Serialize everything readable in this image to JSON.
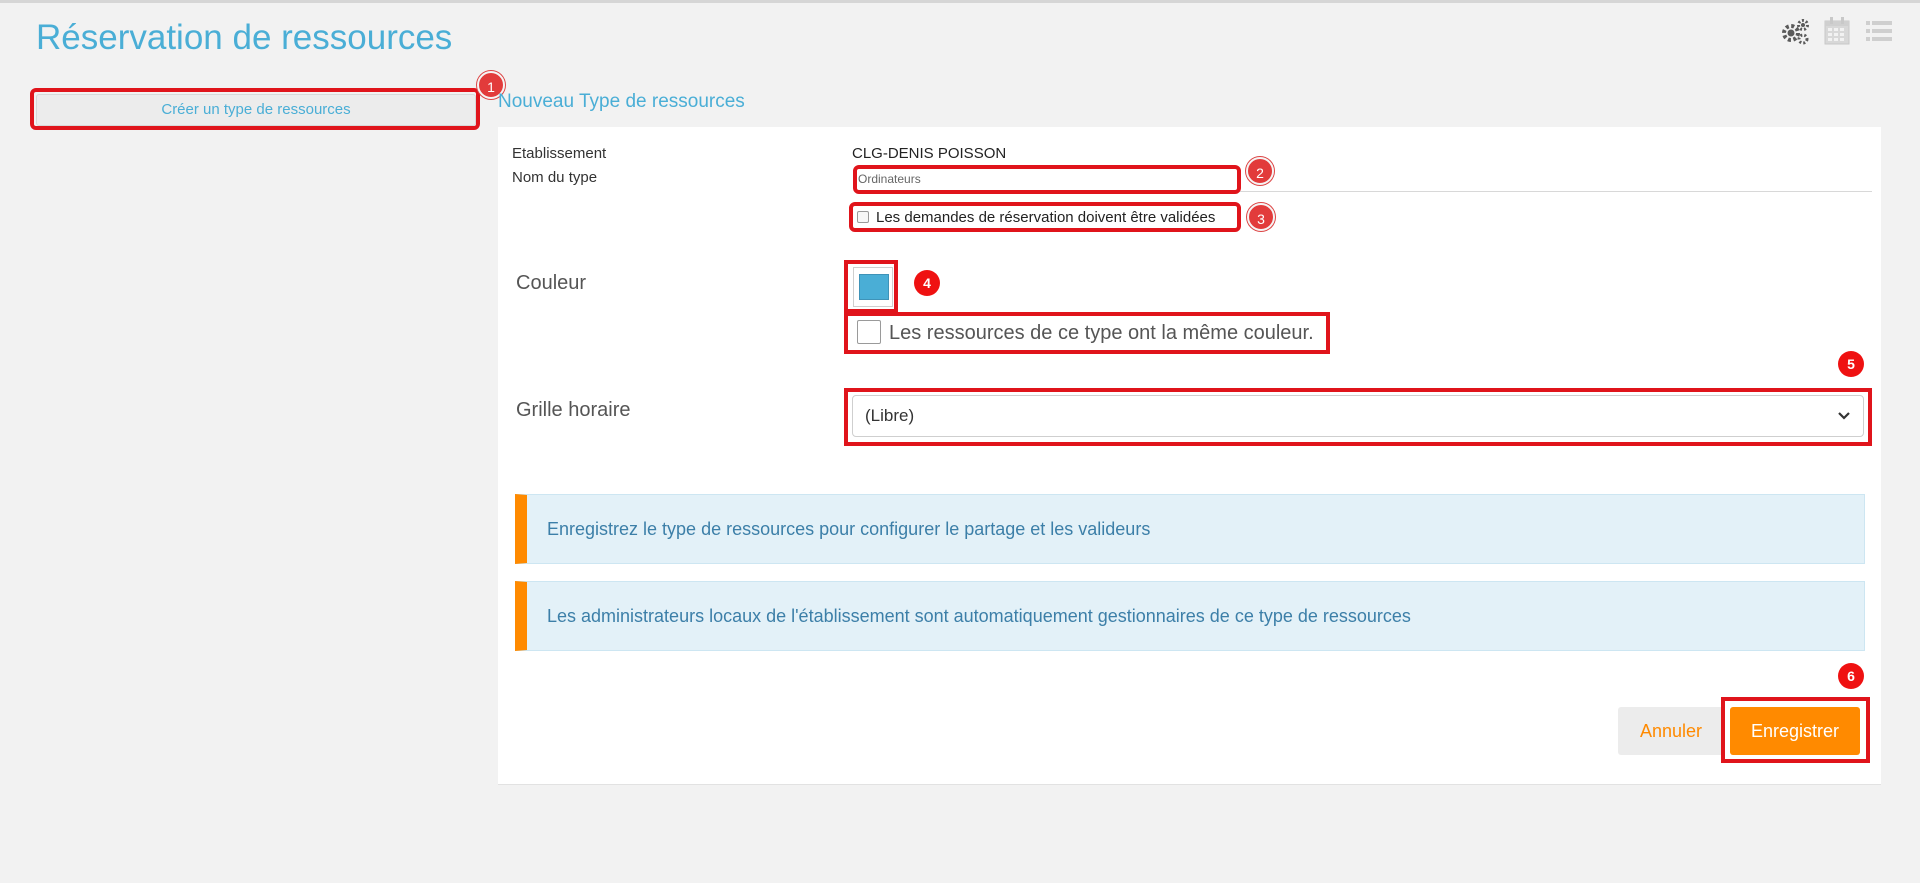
{
  "header": {
    "title": "Réservation de ressources",
    "icons": [
      "gears-icon",
      "calendar-icon",
      "list-icon"
    ]
  },
  "sidebar": {
    "create_label": "Créer un type de ressources"
  },
  "form": {
    "section_title": "Nouveau Type de ressources",
    "etablissement_label": "Etablissement",
    "etablissement_value": "CLG-DENIS POISSON",
    "nom_label": "Nom du type",
    "nom_value": "Ordinateurs",
    "validation_label": "Les demandes de réservation doivent être validées",
    "validation_checked": false,
    "couleur_label": "Couleur",
    "couleur_value": "#4aaed6",
    "same_color_label": "Les ressources de ce type ont la même couleur.",
    "same_color_checked": false,
    "grille_label": "Grille horaire",
    "grille_value": "(Libre)"
  },
  "infos": [
    "Enregistrez le type de ressources pour configurer le partage et les valideurs",
    "Les administrateurs locaux de l'établissement sont automatiquement gestionnaires de ce type de ressources"
  ],
  "actions": {
    "cancel_label": "Annuler",
    "save_label": "Enregistrer"
  },
  "annotations": [
    "1",
    "2",
    "3",
    "4",
    "5",
    "6"
  ],
  "colors": {
    "accent": "#4aaed6",
    "orange": "#ff8a00",
    "highlight": "#e0141b"
  }
}
